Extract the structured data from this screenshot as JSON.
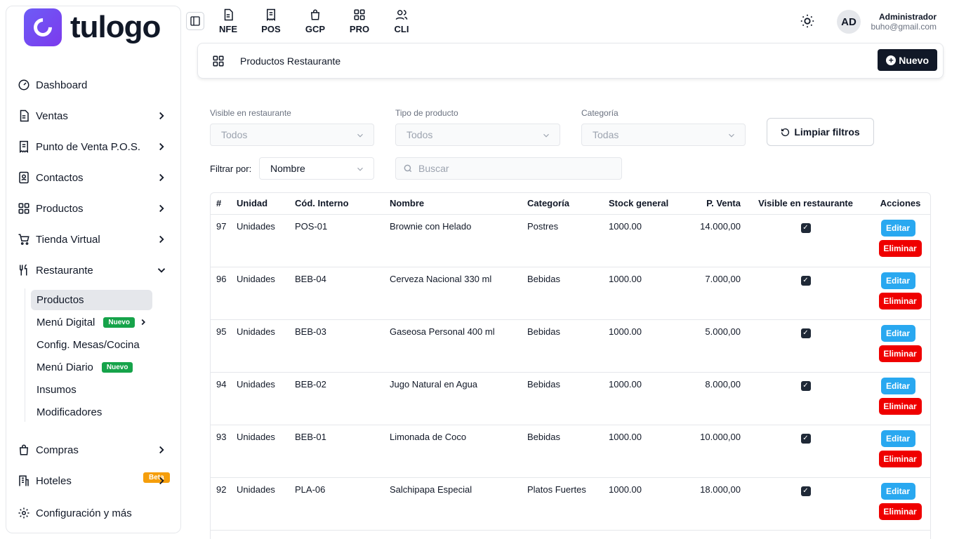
{
  "brand": {
    "name": "tulogo"
  },
  "sidebar": {
    "items": [
      {
        "label": "Dashboard",
        "icon": "gauge-icon"
      },
      {
        "label": "Ventas",
        "icon": "document-icon"
      },
      {
        "label": "Punto de Venta P.O.S.",
        "icon": "receipt-icon"
      },
      {
        "label": "Contactos",
        "icon": "contacts-icon"
      },
      {
        "label": "Productos",
        "icon": "grid-icon"
      },
      {
        "label": "Tienda Virtual",
        "icon": "cart-icon"
      },
      {
        "label": "Restaurante",
        "icon": "utensils-icon"
      },
      {
        "label": "Compras",
        "icon": "bag-icon"
      },
      {
        "label": "Hoteles",
        "icon": "hotel-icon",
        "badge": "Beta"
      },
      {
        "label": "Configuración y más",
        "icon": "gear-icon"
      }
    ],
    "restaurant_sub": [
      {
        "label": "Productos"
      },
      {
        "label": "Menú Digital",
        "badge": "Nuevo"
      },
      {
        "label": "Config. Mesas/Cocina"
      },
      {
        "label": "Menú Diario",
        "badge": "Nuevo"
      },
      {
        "label": "Insumos"
      },
      {
        "label": "Modificadores"
      }
    ]
  },
  "topnav": [
    "NFE",
    "POS",
    "GCP",
    "PRO",
    "CLI"
  ],
  "user": {
    "initials": "AD",
    "name": "Administrador",
    "email": "buho@gmail.com"
  },
  "header": {
    "title": "Productos Restaurante",
    "new_label": "Nuevo"
  },
  "filters": {
    "visible_label": "Visible en restaurante",
    "visible_value": "Todos",
    "type_label": "Tipo de producto",
    "type_value": "Todos",
    "category_label": "Categoría",
    "category_value": "Todas",
    "clear_label": "Limpiar filtros",
    "filter_by_label": "Filtrar por:",
    "filter_by_value": "Nombre",
    "search_placeholder": "Buscar"
  },
  "table": {
    "headers": [
      "#",
      "Unidad",
      "Cód. Interno",
      "Nombre",
      "Categoría",
      "Stock general",
      "P. Venta",
      "Visible en restaurante",
      "Acciones"
    ],
    "edit_label": "Editar",
    "delete_label": "Eliminar",
    "rows": [
      {
        "id": "97",
        "unit": "Unidades",
        "code": "POS-01",
        "name": "Brownie con Helado",
        "category": "Postres",
        "stock": "1000.00",
        "price": "14.000,00"
      },
      {
        "id": "96",
        "unit": "Unidades",
        "code": "BEB-04",
        "name": "Cerveza Nacional 330 ml",
        "category": "Bebidas",
        "stock": "1000.00",
        "price": "7.000,00"
      },
      {
        "id": "95",
        "unit": "Unidades",
        "code": "BEB-03",
        "name": "Gaseosa Personal 400 ml",
        "category": "Bebidas",
        "stock": "1000.00",
        "price": "5.000,00"
      },
      {
        "id": "94",
        "unit": "Unidades",
        "code": "BEB-02",
        "name": "Jugo Natural en Agua",
        "category": "Bebidas",
        "stock": "1000.00",
        "price": "8.000,00"
      },
      {
        "id": "93",
        "unit": "Unidades",
        "code": "BEB-01",
        "name": "Limonada de Coco",
        "category": "Bebidas",
        "stock": "1000.00",
        "price": "10.000,00"
      },
      {
        "id": "92",
        "unit": "Unidades",
        "code": "PLA-06",
        "name": "Salchipapa Especial",
        "category": "Platos Fuertes",
        "stock": "1000.00",
        "price": "18.000,00"
      }
    ]
  }
}
